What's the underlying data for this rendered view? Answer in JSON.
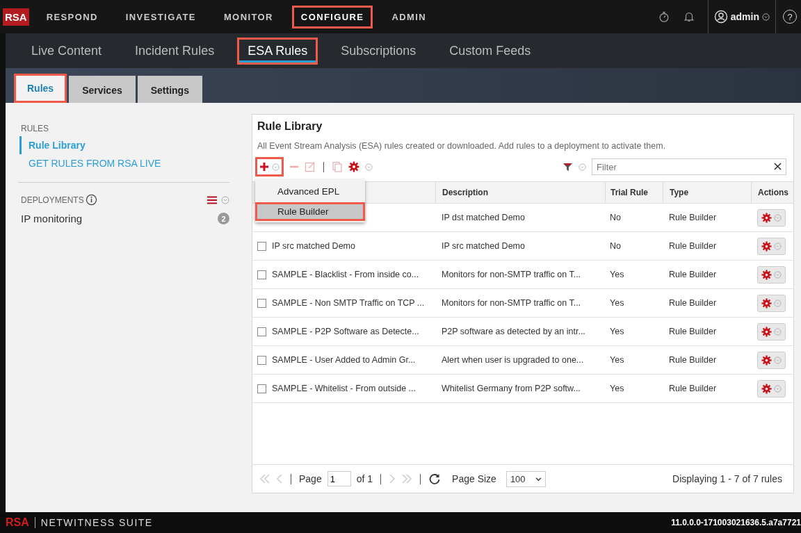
{
  "top_nav": {
    "logo": "RSA",
    "items": [
      {
        "label": "RESPOND",
        "selected": false,
        "highlighted": false
      },
      {
        "label": "INVESTIGATE",
        "selected": false,
        "highlighted": false
      },
      {
        "label": "MONITOR",
        "selected": false,
        "highlighted": false
      },
      {
        "label": "CONFIGURE",
        "selected": true,
        "highlighted": true
      },
      {
        "label": "ADMIN",
        "selected": false,
        "highlighted": false
      }
    ],
    "user": "admin",
    "help": "?"
  },
  "sub_nav": [
    {
      "label": "Live Content",
      "selected": false,
      "highlighted": false
    },
    {
      "label": "Incident Rules",
      "selected": false,
      "highlighted": false
    },
    {
      "label": "ESA Rules",
      "selected": true,
      "highlighted": true
    },
    {
      "label": "Subscriptions",
      "selected": false,
      "highlighted": false
    },
    {
      "label": "Custom Feeds",
      "selected": false,
      "highlighted": false
    }
  ],
  "tabs": [
    {
      "label": "Rules",
      "selected": true,
      "highlighted": true
    },
    {
      "label": "Services",
      "selected": false,
      "highlighted": false
    },
    {
      "label": "Settings",
      "selected": false,
      "highlighted": false
    }
  ],
  "sidebar": {
    "rules_heading": "RULES",
    "items": [
      {
        "label": "Rule Library",
        "selected": true
      },
      {
        "label": "GET RULES FROM RSA LIVE",
        "selected": false
      }
    ],
    "deployments_heading": "DEPLOYMENTS",
    "deployments": [
      {
        "name": "IP monitoring",
        "count": "2"
      }
    ]
  },
  "rule_library": {
    "title": "Rule Library",
    "description": "All Event Stream Analysis (ESA) rules created or downloaded. Add rules to a deployment to activate them.",
    "add_button": {
      "highlighted": true
    },
    "add_menu": [
      {
        "label": "Advanced EPL",
        "highlighted": false
      },
      {
        "label": "Rule Builder",
        "highlighted": true
      }
    ],
    "filter_placeholder": "Filter",
    "columns": [
      "Description",
      "Trial Rule",
      "Type",
      "Actions"
    ],
    "rows": [
      {
        "description": "IP dst matched Demo",
        "trial_rule": "No",
        "type": "Rule Builder"
      },
      {
        "name": "IP src matched Demo",
        "checked": false,
        "description": "IP src matched Demo",
        "trial_rule": "No",
        "type": "Rule Builder"
      },
      {
        "name": "SAMPLE - Blacklist - From inside co...",
        "checked": false,
        "description": "Monitors for non-SMTP traffic on T...",
        "trial_rule": "Yes",
        "type": "Rule Builder"
      },
      {
        "name": "SAMPLE - Non SMTP Traffic on TCP ...",
        "checked": false,
        "description": "Monitors for non-SMTP traffic on T...",
        "trial_rule": "Yes",
        "type": "Rule Builder"
      },
      {
        "name": "SAMPLE - P2P Software as Detecte...",
        "checked": false,
        "description": "P2P software as detected by an intr...",
        "trial_rule": "Yes",
        "type": "Rule Builder"
      },
      {
        "name": "SAMPLE - User Added to Admin Gr...",
        "checked": false,
        "description": "Alert when user is upgraded to one...",
        "trial_rule": "Yes",
        "type": "Rule Builder"
      },
      {
        "name": "SAMPLE - Whitelist - From outside ...",
        "checked": false,
        "description": "Whitelist Germany from P2P softw...",
        "trial_rule": "Yes",
        "type": "Rule Builder"
      }
    ],
    "pagination": {
      "page_label": "Page",
      "page": "1",
      "of": "of 1",
      "page_size_label": "Page Size",
      "page_size": "100",
      "displaying": "Displaying 1 - 7 of 7 rules"
    }
  },
  "footer": {
    "brand": "RSA",
    "product": "NETWITNESS SUITE",
    "version": "11.0.0.0-171003021636.5.a7a7721"
  }
}
